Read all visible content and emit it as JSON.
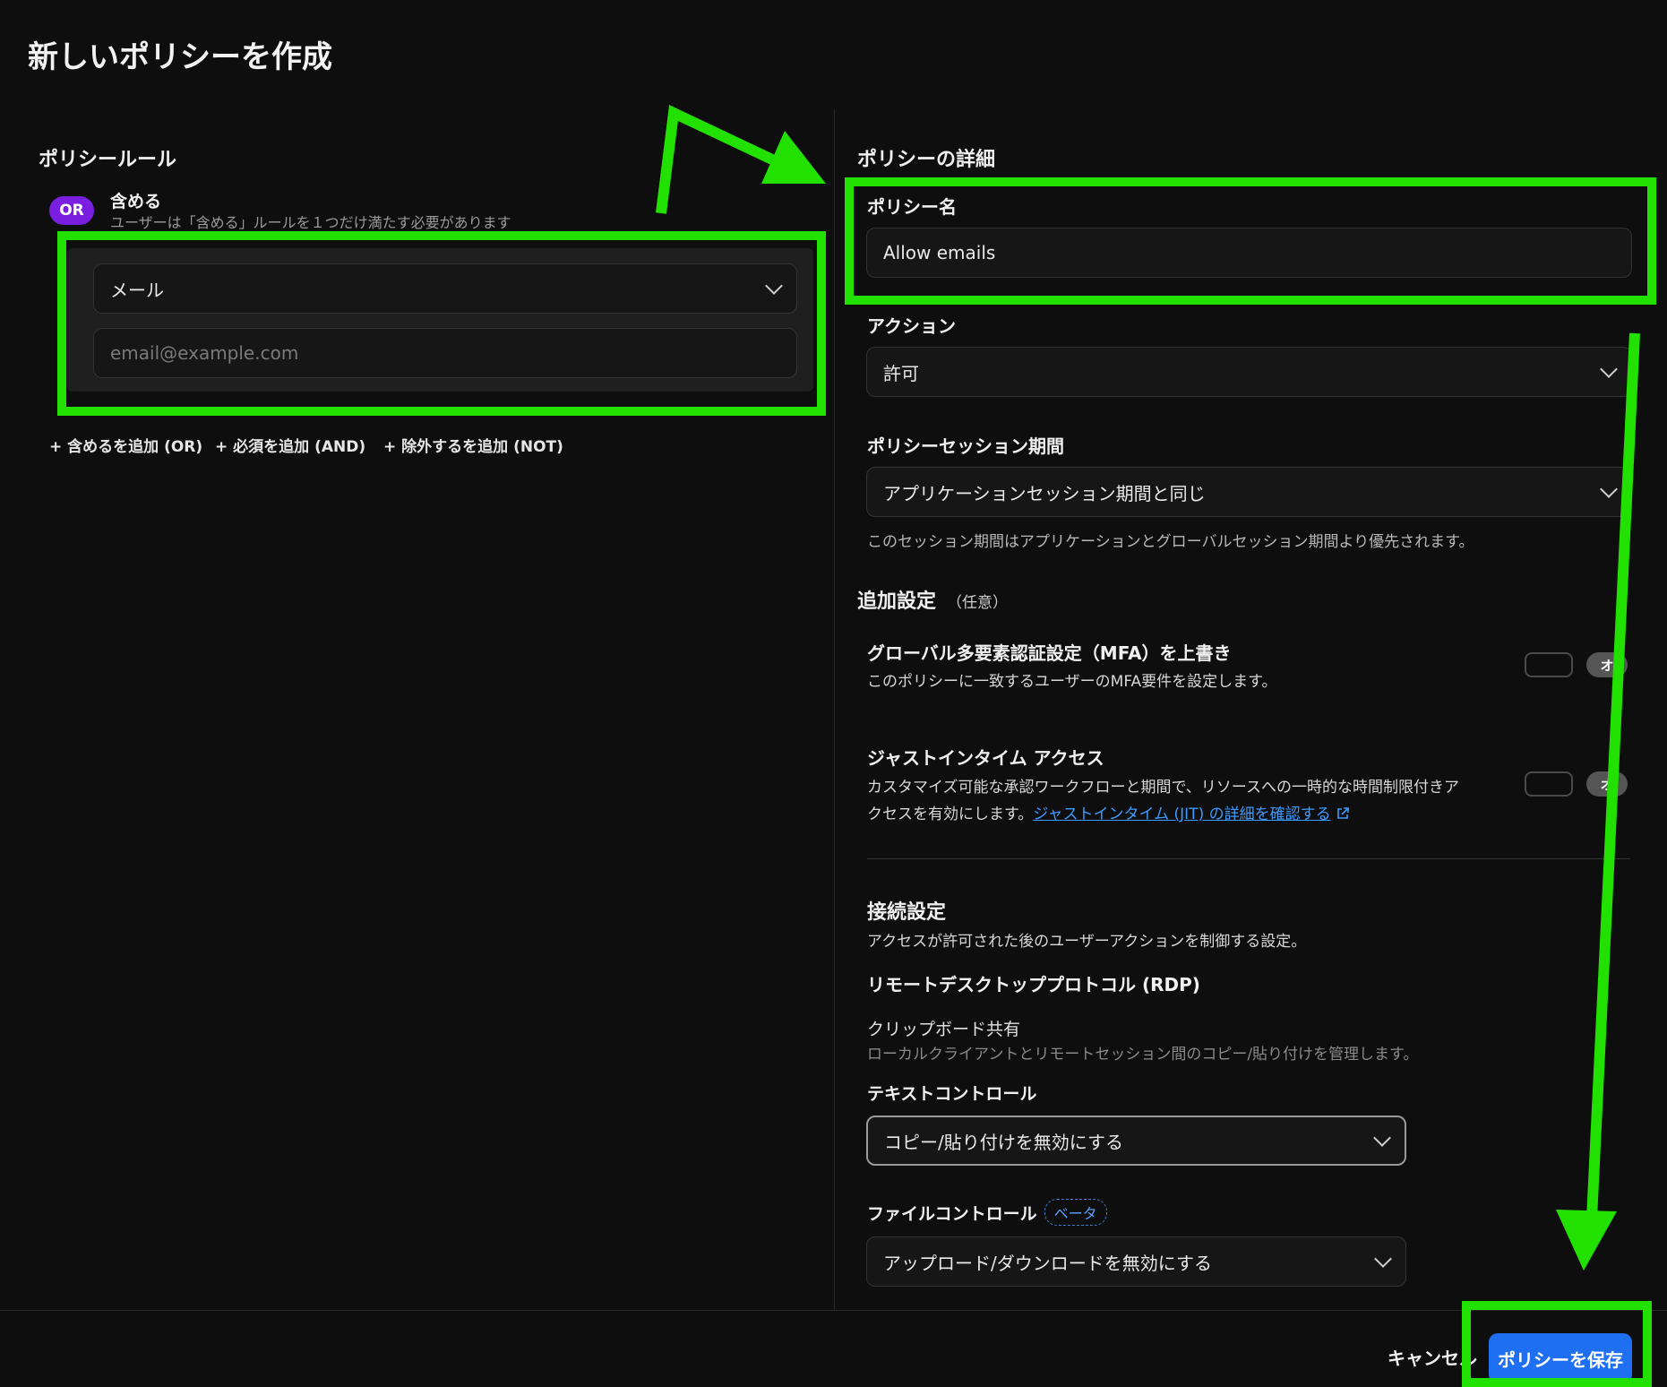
{
  "page": {
    "title": "新しいポリシーを作成"
  },
  "rules": {
    "heading": "ポリシールール",
    "or_badge": "OR",
    "include_title": "含める",
    "include_desc": "ユーザーは「含める」ルールを１つだけ満たす必要があります",
    "selector_value": "メール",
    "email_placeholder": "email@example.com",
    "add_include": "+ 含めるを追加 (OR)",
    "add_require": "+ 必須を追加 (AND)",
    "add_exclude": "+ 除外するを追加 (NOT)"
  },
  "details": {
    "heading": "ポリシーの詳細",
    "name_label": "ポリシー名",
    "name_value": "Allow emails",
    "action_label": "アクション",
    "action_value": "許可",
    "session_label": "ポリシーセッション期間",
    "session_value": "アプリケーションセッション期間と同じ",
    "session_help": "このセッション期間はアプリケーションとグローバルセッション期間より優先されます。"
  },
  "additional": {
    "heading": "追加設定",
    "optional": "（任意）",
    "mfa_title": "グローバル多要素認証設定（MFA）を上書き",
    "mfa_desc": "このポリシーに一致するユーザーのMFA要件を設定します。",
    "mfa_tag": "オ",
    "jit_title": "ジャストインタイム アクセス",
    "jit_desc_1": "カスタマイズ可能な承認ワークフローと期間で、リソースへの一時的な時間制限付きア",
    "jit_desc_2": "クセスを有効にします。",
    "jit_link": "ジャストインタイム (JIT) の詳細を確認する",
    "jit_tag": "オ"
  },
  "connection": {
    "heading": "接続設定",
    "desc": "アクセスが許可された後のユーザーアクションを制御する設定。",
    "rdp_title": "リモートデスクトッププロトコル (RDP)",
    "clipboard_title": "クリップボード共有",
    "clipboard_desc": "ローカルクライアントとリモートセッション間のコピー/貼り付けを管理します。",
    "text_control_label": "テキストコントロール",
    "text_control_value": "コピー/貼り付けを無効にする",
    "file_control_label": "ファイルコントロール",
    "beta": "ベータ",
    "file_control_value": "アップロード/ダウンロードを無効にする"
  },
  "footer": {
    "cancel": "キャンセル",
    "save": "ポリシーを保存"
  },
  "colors": {
    "background": "#0e0e0e",
    "accent_blue": "#1e6ff2",
    "or_badge_purple": "#7a1fe0",
    "annotation_green": "#22e000",
    "link": "#3d9bff"
  }
}
